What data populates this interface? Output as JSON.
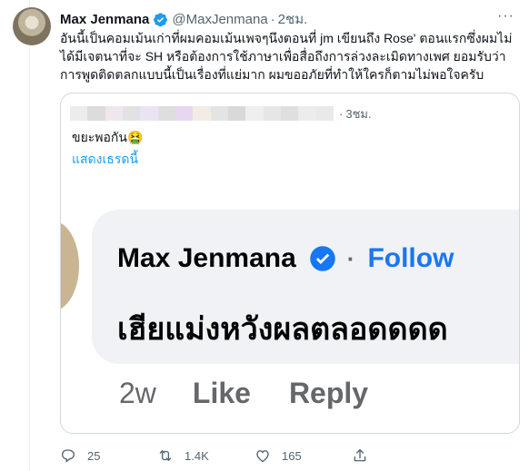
{
  "tweet": {
    "display_name": "Max Jenmana",
    "handle": "@MaxJenmana",
    "separator": "·",
    "time": "2ชม.",
    "more": "···",
    "text_line1": "อันนี้เป็นคอมเม้นเก่าที่ผมคอมเม้นเพจๆนึงตอนที่ jm เขียนถึง Rose' ตอนแรกซึ่งผมไม่",
    "text_line2": "ได้มีเจตนาที่จะ SH หรือต้องการใช้ภาษาเพื่อสื่อถึงการล่วงละเมิดทางเพศ ยอมรับว่า",
    "text_line3": "การพูดติดตลกแบบนี้เป็นเรื่องที่แย่มาก ผมขออภัยที่ทำให้ใครก็ตามไม่พอใจครับ"
  },
  "quote": {
    "separator": "·",
    "time": "3ชม.",
    "text": "ขยะพอกัน🤮",
    "show_thread": "แสดงเธรดนี้"
  },
  "fb_comment": {
    "name": "Max Jenmana",
    "separator": "·",
    "follow": "Follow",
    "comment": "เฮียแม่งหวังผลตลอดดดด",
    "time": "2w",
    "like": "Like",
    "reply": "Reply"
  },
  "actions": {
    "replies": "25",
    "retweets": "1.4K",
    "likes": "165"
  },
  "colors": {
    "accent": "#1d9bf0",
    "fb_blue": "#1877f2",
    "muted": "#536471"
  }
}
